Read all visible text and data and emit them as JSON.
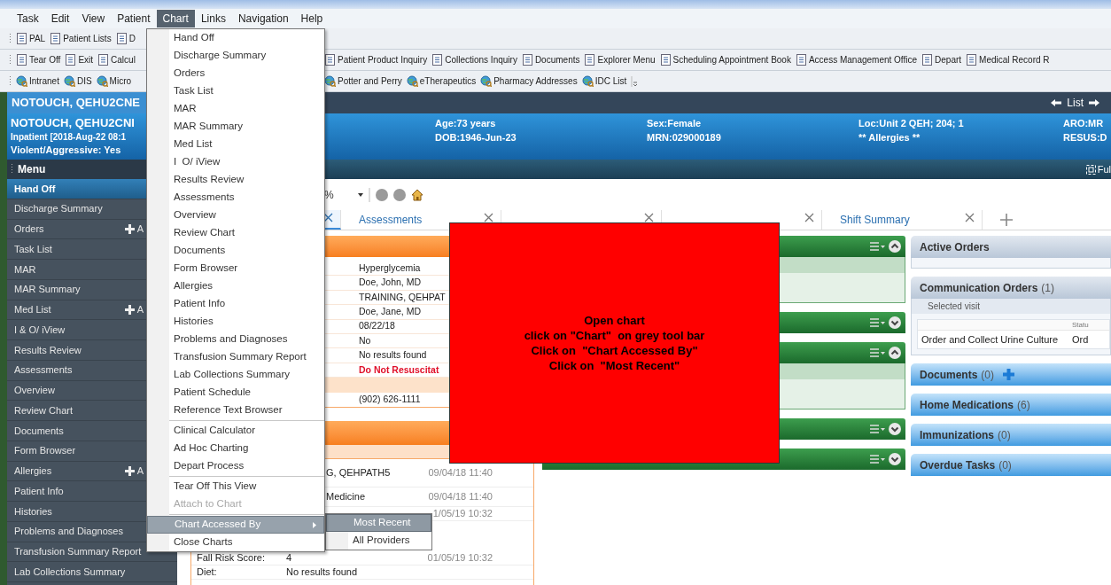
{
  "menu_bar": [
    {
      "label": "Task",
      "selected": false
    },
    {
      "label": "Edit",
      "selected": false
    },
    {
      "label": "View",
      "selected": false
    },
    {
      "label": "Patient",
      "selected": false
    },
    {
      "label": "Chart",
      "selected": true
    },
    {
      "label": "Links",
      "selected": false
    },
    {
      "label": "Navigation",
      "selected": false
    },
    {
      "label": "Help",
      "selected": false
    }
  ],
  "toolbars": [
    {
      "left": [
        "PAL",
        "Patient Lists",
        "D"
      ]
    },
    {
      "left": [
        "Tear Off",
        "Exit",
        "Calcul"
      ],
      "right": [
        "Patient Product Inquiry",
        "Collections Inquiry",
        "Documents",
        "Explorer Menu",
        "Scheduling Appointment Book",
        "Access Management Office",
        "Depart",
        "Medical Record R"
      ]
    },
    {
      "left": [
        "Intranet",
        "DIS",
        "Micro"
      ],
      "right": [
        "Potter and Perry",
        "eTherapeutics",
        "Pharmacy Addresses",
        "IDC List"
      ]
    }
  ],
  "patient_bar": {
    "name": "NOTOUCH, QEHU2CNE",
    "nav_label": "List"
  },
  "banner": {
    "name": "NOTOUCH, QEHU2CNI",
    "encounter": "Inpatient [2018-Aug-22 08:1",
    "alert": "Violent/Aggressive: Yes",
    "columns": [
      [
        "Age:73 years",
        "DOB:1946-Jun-23"
      ],
      [
        "Sex:Female",
        "MRN:029000189"
      ],
      [
        "Loc:Unit 2 QEH; 204; 1",
        "** Allergies **"
      ],
      [
        "ARO:MR",
        "RESUS:D"
      ]
    ]
  },
  "menu_header": {
    "title": "Menu",
    "full_screen": "Ful"
  },
  "sidebar": {
    "items": [
      {
        "label": "Hand Off",
        "selected": true
      },
      {
        "label": "Discharge Summary",
        "selected": false
      },
      {
        "label": "Orders",
        "selected": false,
        "add": "A"
      },
      {
        "label": "Task List",
        "selected": false
      },
      {
        "label": "MAR",
        "selected": false
      },
      {
        "label": "MAR Summary",
        "selected": false
      },
      {
        "label": "Med List",
        "selected": false,
        "add": "A"
      },
      {
        "label": "I & O/ iView",
        "selected": false
      },
      {
        "label": "Results Review",
        "selected": false
      },
      {
        "label": "Assessments",
        "selected": false
      },
      {
        "label": "Overview",
        "selected": false
      },
      {
        "label": "Review Chart",
        "selected": false
      },
      {
        "label": "Documents",
        "selected": false
      },
      {
        "label": "Form Browser",
        "selected": false
      },
      {
        "label": "Allergies",
        "selected": false,
        "add": "A"
      },
      {
        "label": "Patient Info",
        "selected": false
      },
      {
        "label": "Histories",
        "selected": false
      },
      {
        "label": "Problems and Diagnoses",
        "selected": false
      },
      {
        "label": "Transfusion Summary Report",
        "selected": false
      },
      {
        "label": "Lab Collections Summary",
        "selected": false
      }
    ]
  },
  "view_toolbar": {
    "zoom": "%"
  },
  "tabs": [
    {
      "selected": true
    },
    {
      "label": "Assessments",
      "selected": false
    },
    {
      "selected": false
    },
    {
      "selected": false
    },
    {
      "label": "Shift Summary",
      "selected": false
    }
  ],
  "left_column": {
    "rows": [
      {
        "value": "Hyperglycemia",
        "alert": false
      },
      {
        "value": "Doe, John, MD",
        "alert": false
      },
      {
        "value": "TRAINING, QEHPAT",
        "alert": false
      },
      {
        "value": "Doe, Jane, MD",
        "alert": false
      },
      {
        "value": "08/22/18",
        "alert": false
      },
      {
        "value": "No",
        "alert": false
      },
      {
        "value": "No results found",
        "alert": false
      },
      {
        "value": "Do Not Resuscitat",
        "alert": true
      }
    ],
    "contact": "(902) 626-1111",
    "activity": [
      {
        "value": "G, QEHPATH5",
        "time": "09/04/18 11:40"
      },
      {
        "value": "Medicine",
        "time": "09/04/18 11:40"
      },
      {
        "time": "1/05/19 10:32"
      },
      {
        "label": "Fall Risk Score:",
        "value": "4",
        "time": "01/05/19 10:32"
      },
      {
        "label": "Diet:",
        "value": "No results found"
      }
    ]
  },
  "middle_panels": [
    {
      "expanded": true
    },
    {
      "expanded": false
    },
    {
      "expanded": true
    },
    {
      "expanded": false
    },
    {
      "expanded": false
    }
  ],
  "right_column": [
    {
      "title": "Active Orders",
      "expanded": true
    },
    {
      "title": "Communication Orders",
      "count": "(1)",
      "expanded": true,
      "filter": "Selected visit",
      "status_heading": "Statu",
      "rows": [
        [
          "Order and Collect Urine Culture",
          "Ord"
        ]
      ]
    },
    {
      "title": "Documents",
      "count": "(0)",
      "expanded": false,
      "add": true
    },
    {
      "title": "Home Medications",
      "count": "(6)",
      "expanded": false
    },
    {
      "title": "Immunizations",
      "count": "(0)",
      "expanded": false
    },
    {
      "title": "Overdue Tasks",
      "count": "(0)",
      "expanded": false
    }
  ],
  "note": {
    "lines": [
      "Open chart",
      "click on \"Chart\"  on grey tool bar",
      "Click on  \"Chart Accessed By\"",
      "Click on  \"Most Recent\""
    ]
  },
  "chart_menu": [
    {
      "kind": "item",
      "label": "Hand Off",
      "selected": false,
      "disabled": false
    },
    {
      "kind": "item",
      "label": "Discharge Summary",
      "selected": false,
      "disabled": false
    },
    {
      "kind": "item",
      "label": "Orders",
      "selected": false,
      "disabled": false
    },
    {
      "kind": "item",
      "label": "Task List",
      "selected": false,
      "disabled": false
    },
    {
      "kind": "item",
      "label": "MAR",
      "selected": false,
      "disabled": false
    },
    {
      "kind": "item",
      "label": "MAR Summary",
      "selected": false,
      "disabled": false
    },
    {
      "kind": "item",
      "label": "Med List",
      "selected": false,
      "disabled": false
    },
    {
      "kind": "item",
      "label": "I  O/ iView",
      "selected": false,
      "disabled": false
    },
    {
      "kind": "item",
      "label": "Results Review",
      "selected": false,
      "disabled": false
    },
    {
      "kind": "item",
      "label": "Assessments",
      "selected": false,
      "disabled": false
    },
    {
      "kind": "item",
      "label": "Overview",
      "selected": false,
      "disabled": false
    },
    {
      "kind": "item",
      "label": "Review Chart",
      "selected": false,
      "disabled": false
    },
    {
      "kind": "item",
      "label": "Documents",
      "selected": false,
      "disabled": false
    },
    {
      "kind": "item",
      "label": "Form Browser",
      "selected": false,
      "disabled": false
    },
    {
      "kind": "item",
      "label": "Allergies",
      "selected": false,
      "disabled": false
    },
    {
      "kind": "item",
      "label": "Patient Info",
      "selected": false,
      "disabled": false
    },
    {
      "kind": "item",
      "label": "Histories",
      "selected": false,
      "disabled": false
    },
    {
      "kind": "item",
      "label": "Problems and Diagnoses",
      "selected": false,
      "disabled": false
    },
    {
      "kind": "item",
      "label": "Transfusion Summary Report",
      "selected": false,
      "disabled": false
    },
    {
      "kind": "item",
      "label": "Lab Collections Summary",
      "selected": false,
      "disabled": false
    },
    {
      "kind": "item",
      "label": "Patient Schedule",
      "selected": false,
      "disabled": false
    },
    {
      "kind": "item",
      "label": "Reference Text Browser",
      "selected": false,
      "disabled": false
    },
    {
      "kind": "separator"
    },
    {
      "kind": "item",
      "label": "Clinical Calculator",
      "selected": false,
      "disabled": false
    },
    {
      "kind": "item",
      "label": "Ad Hoc Charting",
      "selected": false,
      "disabled": false
    },
    {
      "kind": "item",
      "label": "Depart Process",
      "selected": false,
      "disabled": false
    },
    {
      "kind": "separator"
    },
    {
      "kind": "item",
      "label": "Tear Off This View",
      "selected": false,
      "disabled": false
    },
    {
      "kind": "item",
      "label": "Attach to Chart",
      "selected": false,
      "disabled": true
    },
    {
      "kind": "separator"
    },
    {
      "kind": "item",
      "label": "Chart Accessed By",
      "selected": true,
      "disabled": false,
      "submenu": [
        {
          "label": "Most Recent",
          "selected": true
        },
        {
          "label": "All Providers",
          "selected": false
        }
      ]
    },
    {
      "kind": "item",
      "label": "Close Charts",
      "selected": false,
      "disabled": false
    }
  ]
}
